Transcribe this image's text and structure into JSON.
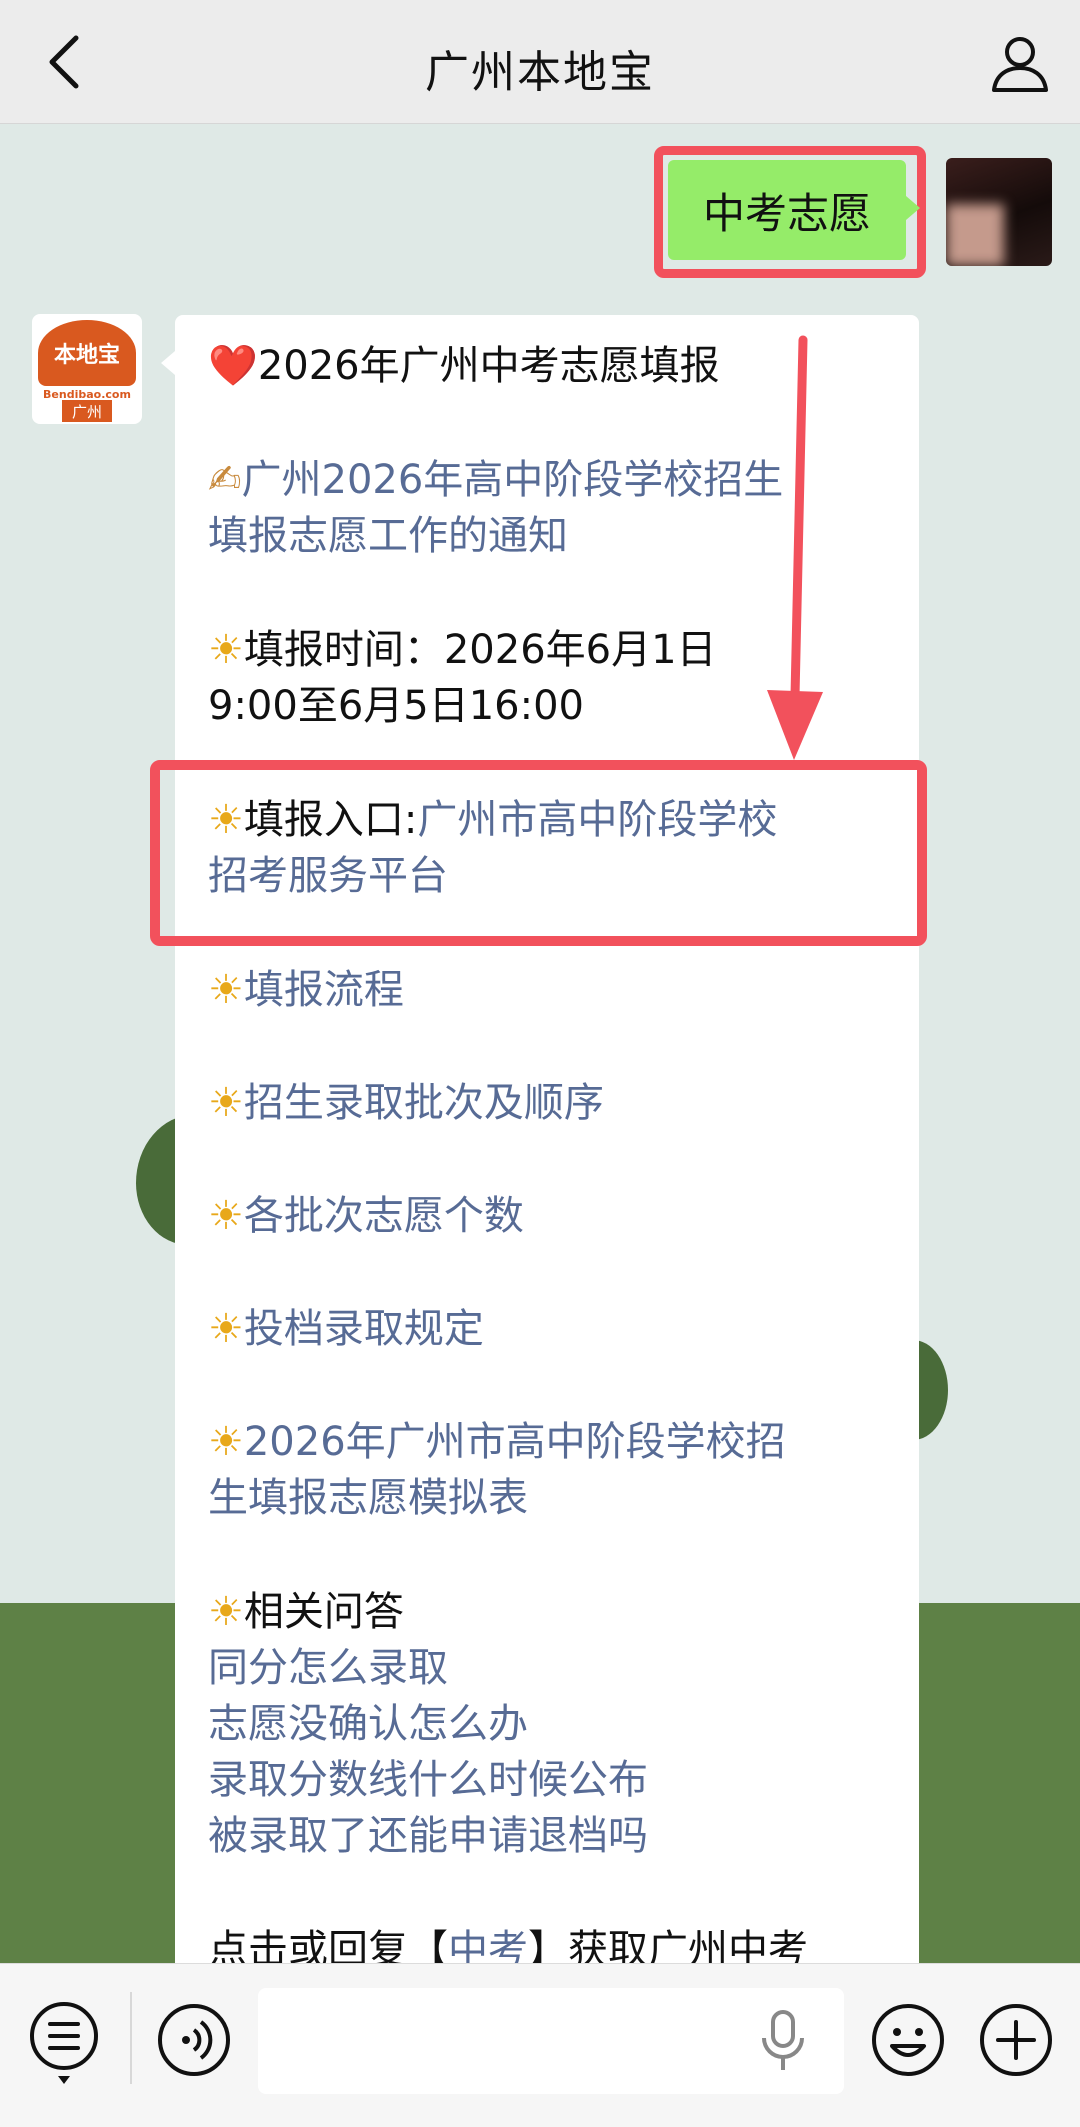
{
  "header": {
    "title": "广州本地宝",
    "back_icon": "chevron-left-icon",
    "profile_icon": "person-icon"
  },
  "outgoing_message": {
    "text": "中考志愿",
    "bubble_color": "#95ec69"
  },
  "bot_avatar": {
    "logo_text": "本地宝",
    "logo_subtext": "Bendibao.com",
    "logo_city": "广州",
    "brand_color": "#d9591f"
  },
  "reply": {
    "title_emoji": "❤️",
    "title": "2026年广州中考志愿填报",
    "notice_emoji": "✍",
    "notice_line1": "广州2026年高中阶段学校招生",
    "notice_line2": "填报志愿工作的通知",
    "time_emoji": "☀",
    "time_line1": "填报时间：2026年6月1日",
    "time_line2": "9:00至6月5日16:00",
    "entrance_emoji": "☀",
    "entrance_label": "填报入口:",
    "entrance_link1": "广州市高中阶段学校",
    "entrance_link2": "招考服务平台",
    "items": [
      {
        "emoji": "☀",
        "text": "填报流程"
      },
      {
        "emoji": "☀",
        "text": "招生录取批次及顺序"
      },
      {
        "emoji": "☀",
        "text": "各批次志愿个数"
      },
      {
        "emoji": "☀",
        "text": "投档录取规定"
      }
    ],
    "sim_emoji": "☀",
    "sim_line1": "2026年广州市高中阶段学校招",
    "sim_line2": "生填报志愿模拟表",
    "faq_emoji": "☀",
    "faq_title": "相关问答",
    "faq": [
      "同分怎么录取",
      "志愿没确认怎么办",
      "录取分数线什么时候公布",
      "被录取了还能申请退档吗"
    ],
    "footer_prefix": "点击或回复【",
    "footer_keyword": "中考",
    "footer_suffix": "】获取广州中考",
    "link_color": "#576b95"
  },
  "annotation": {
    "highlight_color": "#f2515c"
  },
  "bottom_bar": {
    "menu_icon": "menu-list-icon",
    "voice_icon": "voice-icon",
    "input_value": "",
    "mic_icon": "microphone-icon",
    "emoji_icon": "emoji-icon",
    "plus_icon": "plus-icon"
  }
}
